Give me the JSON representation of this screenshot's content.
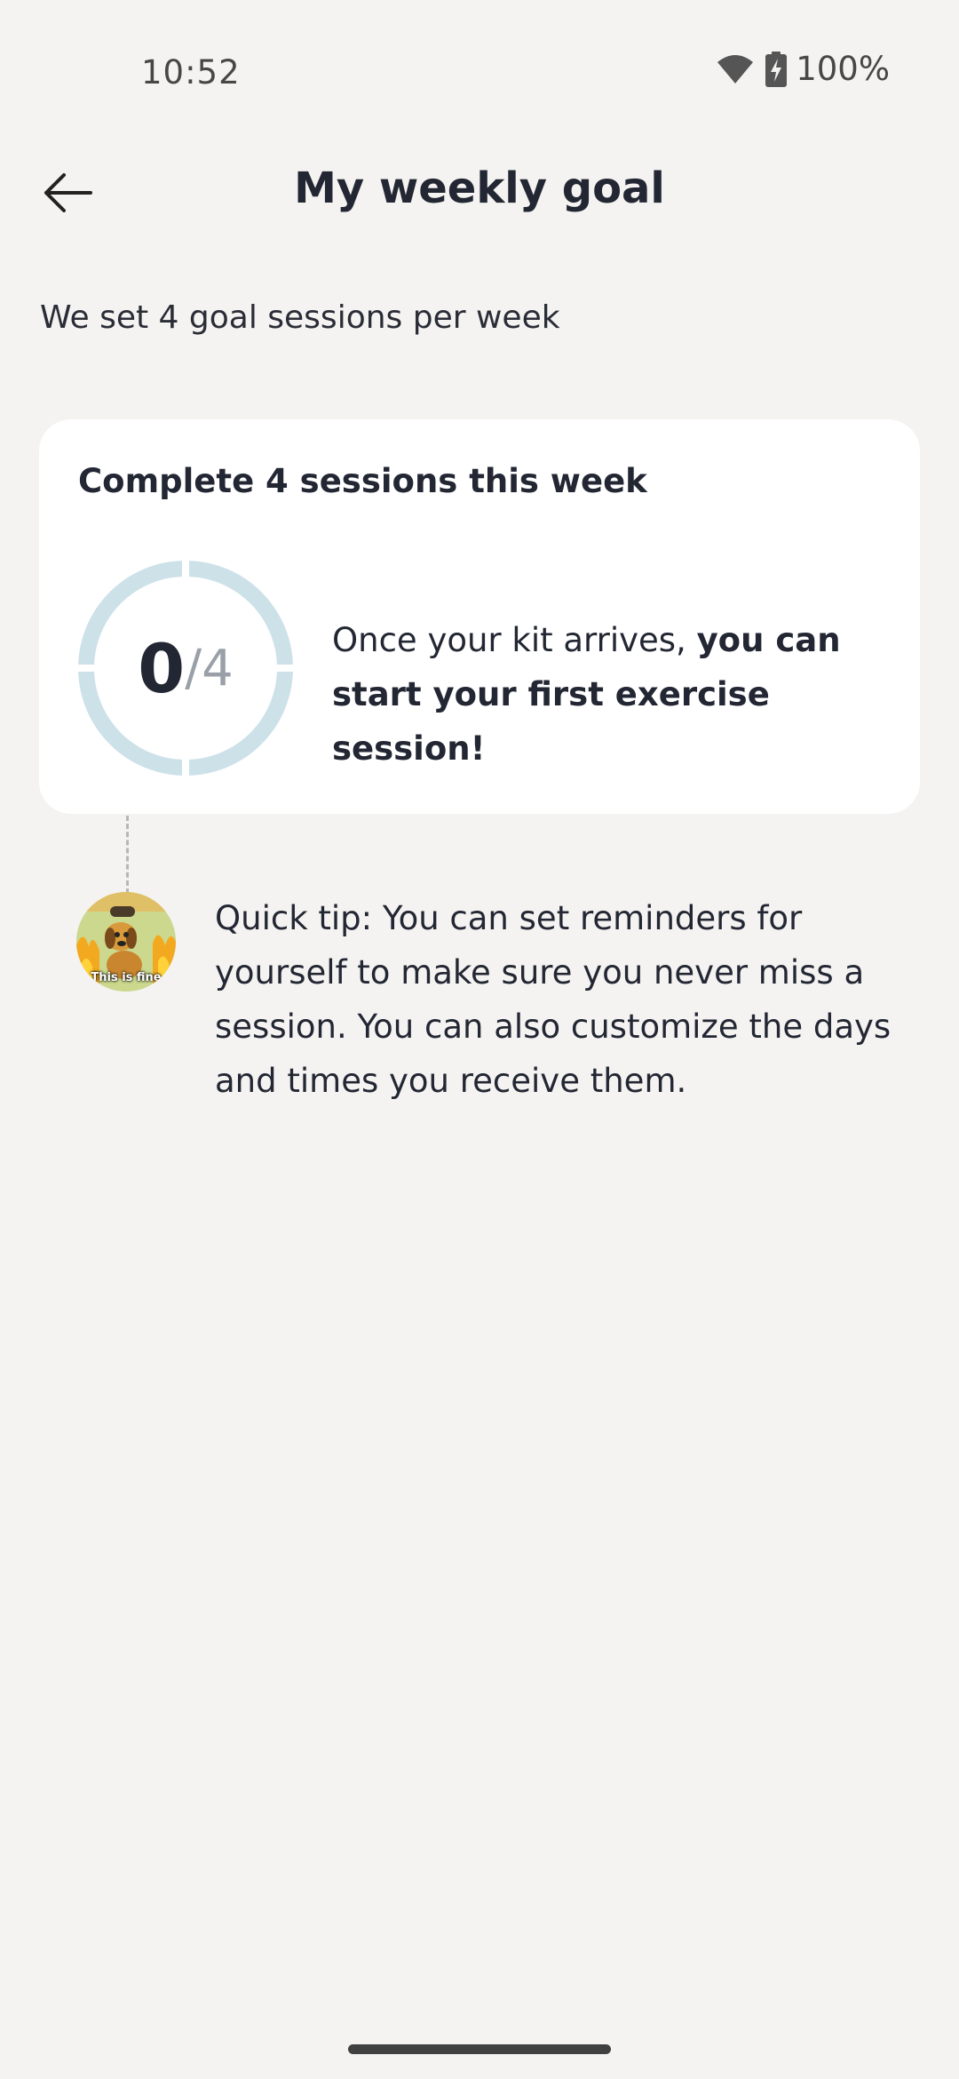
{
  "status_bar": {
    "time": "10:52",
    "battery": "100%",
    "icons": [
      "wifi-icon",
      "battery-charging-icon"
    ]
  },
  "header": {
    "back_icon": "arrow-left-icon",
    "title": "My weekly goal"
  },
  "subtitle": "We set 4 goal sessions per week",
  "goal_card": {
    "title": "Complete 4 sessions this week",
    "progress": {
      "completed": "0",
      "separator": "/",
      "total": "4"
    },
    "message_regular": "Once your kit arrives, ",
    "message_bold": "you can start your first exercise session!"
  },
  "tip": {
    "avatar_caption": "This is fine",
    "text": "Quick tip: You can set reminders for yourself to make sure you never miss a session. You can also customize the days and times you receive them."
  },
  "colors": {
    "background": "#f4f3f1",
    "card": "#ffffff",
    "ring": "#cde1e9",
    "text": "#232733"
  }
}
